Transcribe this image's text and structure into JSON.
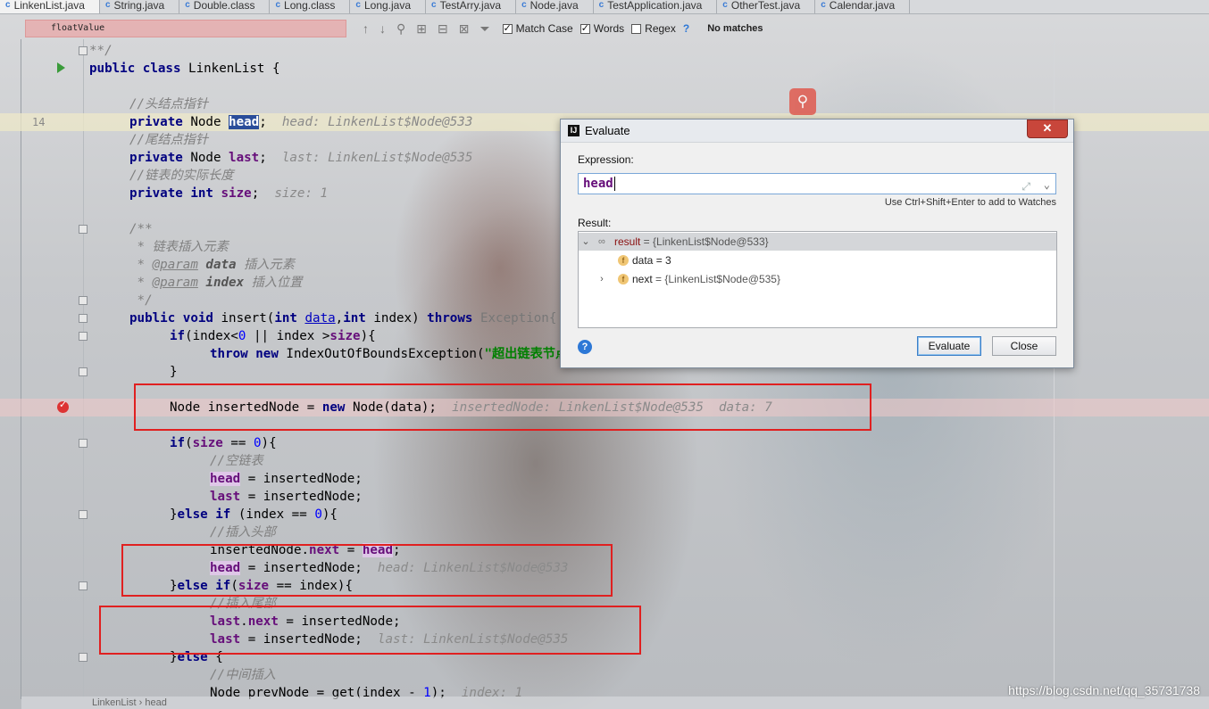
{
  "tabs": [
    {
      "label": "LinkenList.java",
      "icon": "c",
      "active": true
    },
    {
      "label": "String.java",
      "icon": "c"
    },
    {
      "label": "Double.class",
      "icon": "c"
    },
    {
      "label": "Long.class",
      "icon": "c"
    },
    {
      "label": "Long.java",
      "icon": "c"
    },
    {
      "label": "TestArry.java",
      "icon": "c"
    },
    {
      "label": "Node.java",
      "icon": "c"
    },
    {
      "label": "TestApplication.java",
      "icon": "c"
    },
    {
      "label": "OtherTest.java",
      "icon": "c"
    },
    {
      "label": "Calendar.java",
      "icon": "c"
    }
  ],
  "find": {
    "query": "floatValue",
    "match_case": "Match Case",
    "words": "Words",
    "regex": "Regex",
    "regex_help": "?",
    "status": "No matches"
  },
  "editor": {
    "line_number_14": "14",
    "l1": "**/",
    "l2_a": "public class",
    "l2_b": " LinkenList {",
    "l4": "//头结点指针",
    "l5_a": "private",
    "l5_b": " Node ",
    "l5_sel": "head",
    "l5_c": ";  ",
    "l5_dbg": "head: LinkenList$Node@533",
    "l6": "//尾结点指针",
    "l7_a": "private",
    "l7_b": " Node ",
    "l7_f": "last",
    "l7_c": ";  ",
    "l7_dbg": "last: LinkenList$Node@535",
    "l8": "//链表的实际长度",
    "l9_a": "private int",
    "l9_b": " ",
    "l9_f": "size",
    "l9_c": ";  ",
    "l9_dbg": "size: 1",
    "l11": "/**",
    "l12": " * 链表插入元素",
    "l13_a": " * ",
    "l13_tag": "@param",
    "l13_p": " data",
    "l13_c": " 插入元素",
    "l14_a": " * ",
    "l14_tag": "@param",
    "l14_p": " index",
    "l14_c": " 插入位置",
    "l15": " */",
    "l16_a": "public void",
    "l16_b": " insert(",
    "l16_c": "int",
    "l16_d": " ",
    "l16_p": "data",
    "l16_e": ",",
    "l16_f": "int",
    "l16_g": " index) ",
    "l16_h": "throws",
    "l16_i": " Exception{",
    "l17_a": "if",
    "l17_b": "(index<",
    "l17_n": "0",
    "l17_c": " || index >",
    "l17_f": "size",
    "l17_d": "){",
    "l18_a": "throw new",
    "l18_b": " IndexOutOfBoundsException(",
    "l18_s": "\"超出链表节点范围！\"",
    "l19": "}",
    "l21_a": "Node insertedNode = ",
    "l21_kw": "new",
    "l21_b": " Node(data);  ",
    "l21_dbg": "insertedNode: LinkenList$Node@535  data: 7",
    "l23_a": "if",
    "l23_b": "(",
    "l23_f": "size",
    "l23_c": " == ",
    "l23_n": "0",
    "l23_d": "){",
    "l24": "//空链表",
    "l25_f": "head",
    "l25_b": " = insertedNode;",
    "l26_f": "last",
    "l26_b": " = insertedNode;",
    "l27_a": "}",
    "l27_kw": "else if",
    "l27_b": " (index == ",
    "l27_n": "0",
    "l27_c": "){",
    "l28": "//插入头部",
    "l29_a": "insertedNode.",
    "l29_f": "next",
    "l29_b": " = ",
    "l29_g": "head",
    "l29_c": ";",
    "l30_f": "head",
    "l30_b": " = insertedNode;  ",
    "l30_dbg": "head: LinkenList$Node@533",
    "l31_a": "}",
    "l31_kw": "else if",
    "l31_b": "(",
    "l31_f": "size",
    "l31_c": " == index){",
    "l32": "//插入尾部",
    "l33_f": "last",
    "l33_a": ".",
    "l33_g": "next",
    "l33_b": " = insertedNode;",
    "l34_f": "last",
    "l34_b": " = insertedNode;  ",
    "l34_dbg": "last: LinkenList$Node@535",
    "l35_a": "}",
    "l35_kw": "else",
    "l35_b": " {",
    "l36": "//中间插入",
    "l37_a": "Node prevNode = get(index - ",
    "l37_n": "1",
    "l37_b": ");  ",
    "l37_dbg": "index: 1"
  },
  "dialog": {
    "title": "Evaluate",
    "logo": "IJ",
    "close_icon": "✕",
    "expression_label": "Expression:",
    "expression_value": "head",
    "expand_icon": "⤢",
    "dropdown_icon": "⌄",
    "hint": "Use Ctrl+Shift+Enter to add to Watches",
    "result_label": "Result:",
    "result_tree": [
      {
        "name": "result",
        "value": " = {LinkenList$Node@533}"
      },
      {
        "name": "data",
        "value": " = 3"
      },
      {
        "name": "next",
        "value": " = {LinkenList$Node@535}"
      }
    ],
    "field_icon": "f",
    "help": "?",
    "evaluate_button": "Evaluate",
    "close_button": "Close"
  },
  "status": {
    "breadcrumb_1": "LinkenList",
    "breadcrumb_sep": "›",
    "breadcrumb_2": "head"
  },
  "watermark": "https://blog.csdn.net/qq_35731738"
}
